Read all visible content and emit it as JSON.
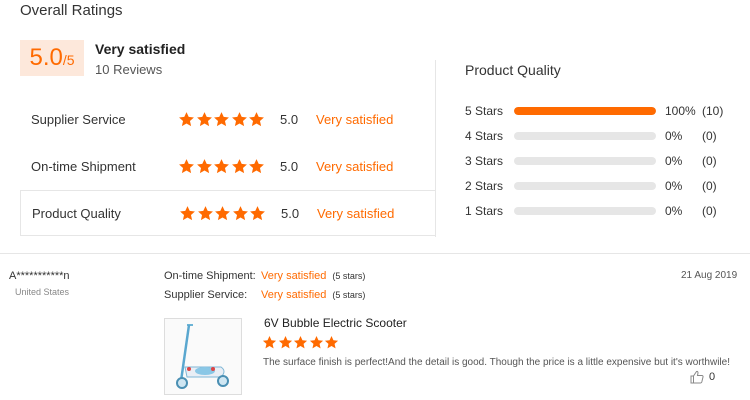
{
  "header": {
    "title": "Overall Ratings"
  },
  "overall": {
    "score": "5.0",
    "score_suffix": "/5",
    "label": "Very satisfied",
    "review_count": "10 Reviews"
  },
  "ratings": [
    {
      "label": "Supplier Service",
      "stars": 5,
      "value": "5.0",
      "text": "Very satisfied"
    },
    {
      "label": "On-time Shipment",
      "stars": 5,
      "value": "5.0",
      "text": "Very satisfied"
    },
    {
      "label": "Product Quality",
      "stars": 5,
      "value": "5.0",
      "text": "Very satisfied"
    }
  ],
  "product_quality": {
    "title": "Product Quality",
    "bars": [
      {
        "label": "5  Stars",
        "fraction": 1.0,
        "percent": "100%",
        "count": "(10)"
      },
      {
        "label": "4  Stars",
        "fraction": 0.0,
        "percent": "0%",
        "count": "(0)"
      },
      {
        "label": "3  Stars",
        "fraction": 0.0,
        "percent": "0%",
        "count": "(0)"
      },
      {
        "label": "2  Stars",
        "fraction": 0.0,
        "percent": "0%",
        "count": "(0)"
      },
      {
        "label": "1  Stars",
        "fraction": 0.0,
        "percent": "0%",
        "count": "(0)"
      }
    ]
  },
  "review": {
    "reviewer": "A***********n",
    "country": "United States",
    "date": "21 Aug 2019",
    "shipment_label": "On-time Shipment:",
    "shipment_value": "Very satisfied",
    "shipment_count": "(5 stars)",
    "service_label": "Supplier Service:",
    "service_value": "Very satisfied",
    "service_count": "(5 stars)",
    "product_title": "6V Bubble Electric Scooter",
    "stars": 5,
    "text": "The surface finish is perfect!And the detail is good. Though the price is a little expensive but it's worthwile!",
    "likes": "0"
  },
  "colors": {
    "accent": "#ff6a00",
    "score_bg": "#fde8db",
    "bar_track": "#e6e6e6"
  },
  "icons": {
    "star": "star-icon",
    "like": "thumbs-up-icon",
    "product": "scooter-thumbnail"
  }
}
